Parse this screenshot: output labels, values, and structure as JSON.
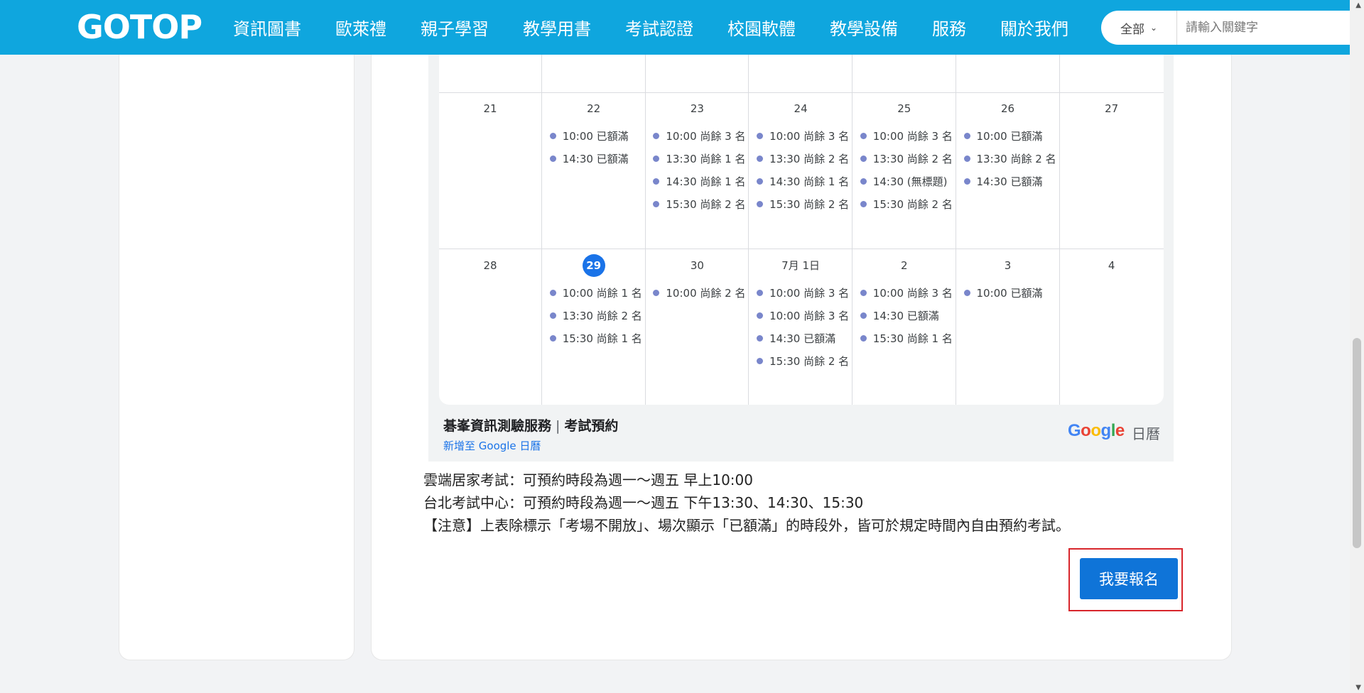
{
  "header": {
    "logo": "GOTOP",
    "nav": [
      "資訊圖書",
      "歐萊禮",
      "親子學習",
      "教學用書",
      "考試認證",
      "校園軟體",
      "教學設備",
      "服務",
      "關於我們"
    ],
    "search": {
      "category": "全部",
      "placeholder": "請輸入關鍵字"
    }
  },
  "calendar": {
    "weeks": [
      {
        "days": [
          {
            "num": "",
            "events": []
          },
          {
            "num": "",
            "events": []
          },
          {
            "num": "",
            "events": []
          },
          {
            "num": "",
            "events": []
          },
          {
            "num": "",
            "events": []
          },
          {
            "num": "",
            "events": []
          },
          {
            "num": "",
            "events": []
          }
        ]
      },
      {
        "days": [
          {
            "num": "21",
            "events": []
          },
          {
            "num": "22",
            "events": [
              "10:00 已額滿",
              "14:30 已額滿"
            ]
          },
          {
            "num": "23",
            "events": [
              "10:00 尚餘 3 名",
              "13:30 尚餘 1 名",
              "14:30 尚餘 1 名",
              "15:30 尚餘 2 名"
            ]
          },
          {
            "num": "24",
            "events": [
              "10:00 尚餘 3 名",
              "13:30 尚餘 2 名",
              "14:30 尚餘 1 名",
              "15:30 尚餘 2 名"
            ]
          },
          {
            "num": "25",
            "events": [
              "10:00 尚餘 3 名",
              "13:30 尚餘 2 名",
              "14:30 (無標題)",
              "15:30 尚餘 2 名"
            ]
          },
          {
            "num": "26",
            "events": [
              "10:00 已額滿",
              "13:30 尚餘 2 名",
              "14:30 已額滿"
            ]
          },
          {
            "num": "27",
            "events": []
          }
        ]
      },
      {
        "days": [
          {
            "num": "28",
            "events": []
          },
          {
            "num": "29",
            "today": true,
            "events": [
              "10:00 尚餘 1 名",
              "13:30 尚餘 2 名",
              "15:30 尚餘 1 名"
            ]
          },
          {
            "num": "30",
            "events": [
              "10:00 尚餘 2 名"
            ]
          },
          {
            "num": "7月 1日",
            "events": [
              "10:00 尚餘 3 名",
              "10:00 尚餘 3 名",
              "14:30 已額滿",
              "15:30 尚餘 2 名"
            ]
          },
          {
            "num": "2",
            "events": [
              "10:00 尚餘 3 名",
              "14:30 已額滿",
              "15:30 尚餘 1 名"
            ]
          },
          {
            "num": "3",
            "events": [
              "10:00 已額滿"
            ]
          },
          {
            "num": "4",
            "events": []
          }
        ]
      }
    ],
    "footer": {
      "title_a": "碁峯資訊測驗服務",
      "separator": "|",
      "title_b": "考試預約",
      "add_link": "新增至 Google 日曆",
      "brand": "Google",
      "brand_label": "日曆"
    },
    "event_color": "#7986cb",
    "today_color": "#1a73e8"
  },
  "info": {
    "line1": "雲端居家考試：可預約時段為週一～週五 早上10:00",
    "line2": "台北考試中心：可預約時段為週一～週五 下午13:30、14:30、15:30",
    "line3": "【注意】上表除標示「考場不開放」、場次顯示「已額滿」的時段外，皆可於規定時間內自由預約考試。"
  },
  "register_button": "我要報名",
  "colors": {
    "header_bg": "#0fa6de",
    "button_bg": "#0f74d8",
    "highlight_border": "#d8262c"
  }
}
